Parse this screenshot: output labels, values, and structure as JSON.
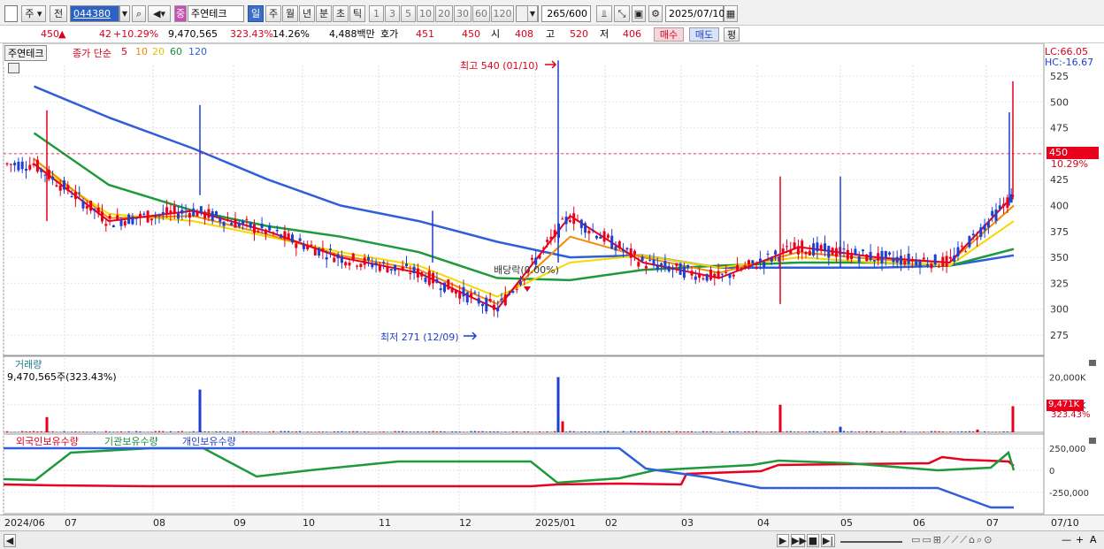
{
  "toolbar": {
    "mode_label": "주",
    "prev_label": "전",
    "stock_code": "044380",
    "stock_type_badge": "중",
    "stock_name": "주연테크",
    "periods": [
      "일",
      "주",
      "월",
      "년",
      "분",
      "초",
      "틱"
    ],
    "selected_period": "일",
    "intervals": [
      "1",
      "3",
      "5",
      "10",
      "20",
      "30",
      "60",
      "120"
    ],
    "count_current": "265",
    "count_total": "/600",
    "date": "2025/07/10"
  },
  "quote": {
    "price": "450",
    "direction_icon": "up-triangle-icon",
    "change": "42",
    "change_pct": "+10.29%",
    "volume": "9,470,565",
    "volume_ratio": "323.43%",
    "turnover": "14.26%",
    "amount": "4,488백만",
    "hoga_label": "호가",
    "ask_price": "451",
    "bid_price": "450",
    "open_label": "시",
    "open": "408",
    "high_label": "고",
    "high": "520",
    "low_label": "저",
    "low": "406",
    "buy_button": "매수",
    "sell_button": "매도",
    "eval_button": "평"
  },
  "chart": {
    "stock_tag": "주연테크",
    "ma_title": "종가 단순",
    "ma_periods": [
      "5",
      "10",
      "20",
      "60",
      "120"
    ],
    "lc_label": "LC:66.05",
    "hc_label": "HC:-16.67",
    "high_annotation": "최고 540 (01/10)",
    "low_annotation": "최저 271 (12/09)",
    "dividend_annotation": "배당락(0.00%)",
    "current_price_tag": "450",
    "current_pct_tag": "10.29%",
    "price_ticks": [
      "525",
      "500",
      "475",
      "450",
      "425",
      "400",
      "375",
      "350",
      "325",
      "300",
      "275"
    ],
    "volume_title": "거래량",
    "volume_value": "9,470,565주(323.43%)",
    "volume_ticks": [
      "20,000K",
      "10,000K"
    ],
    "volume_current_tag": "9,471K",
    "volume_pct_tag": "323.43%",
    "holding_series": [
      "외국인보유수량",
      "기관보유수량",
      "개인보유수량"
    ],
    "holding_ticks": [
      "250,000",
      "0",
      "-250,000"
    ],
    "x_labels": [
      "2024/06",
      "07",
      "08",
      "09",
      "10",
      "11",
      "12",
      "2025/01",
      "02",
      "03",
      "04",
      "05",
      "06",
      "07",
      "07/10"
    ],
    "colors": {
      "ma5": "#e8001c",
      "ma10": "#f28c00",
      "ma20": "#f5d800",
      "ma60": "#1e9a3c",
      "ma120": "#2f5fd8",
      "up": "#e8001c",
      "down": "#1f3fd0"
    }
  },
  "chart_data": {
    "type": "line",
    "title": "주연테크",
    "xlabel": "",
    "ylabel": "",
    "ylim": [
      260,
      540
    ],
    "x": [
      "2024/06",
      "2024/07",
      "2024/08",
      "2024/09",
      "2024/10",
      "2024/11",
      "2024/12",
      "2025/01",
      "2025/02",
      "2025/03",
      "2025/04",
      "2025/05",
      "2025/06",
      "2025/07"
    ],
    "series": [
      {
        "name": "5",
        "values": [
          440,
          385,
          395,
          375,
          350,
          335,
          300,
          390,
          345,
          330,
          360,
          350,
          345,
          410
        ]
      },
      {
        "name": "10",
        "values": [
          445,
          388,
          390,
          372,
          352,
          338,
          305,
          370,
          350,
          335,
          355,
          348,
          345,
          400
        ]
      },
      {
        "name": "20",
        "values": [
          440,
          392,
          385,
          370,
          355,
          342,
          312,
          345,
          352,
          340,
          350,
          345,
          342,
          385
        ]
      },
      {
        "name": "60",
        "values": [
          470,
          420,
          395,
          380,
          370,
          355,
          330,
          328,
          338,
          342,
          345,
          345,
          342,
          358
        ]
      },
      {
        "name": "120",
        "values": [
          515,
          485,
          455,
          425,
          400,
          385,
          365,
          350,
          352,
          340,
          340,
          340,
          342,
          352
        ]
      }
    ],
    "volume_k": [
      200,
      1500,
      9500,
      400,
      200,
      300,
      300,
      20000,
      600,
      300,
      8500,
      1400,
      500,
      9471
    ]
  },
  "bottom": {
    "nav_buttons": [
      "▶",
      "▶▶",
      "■",
      "▶|"
    ],
    "zoom_minus": "—",
    "zoom_plus": "+",
    "auto_label": "A"
  }
}
